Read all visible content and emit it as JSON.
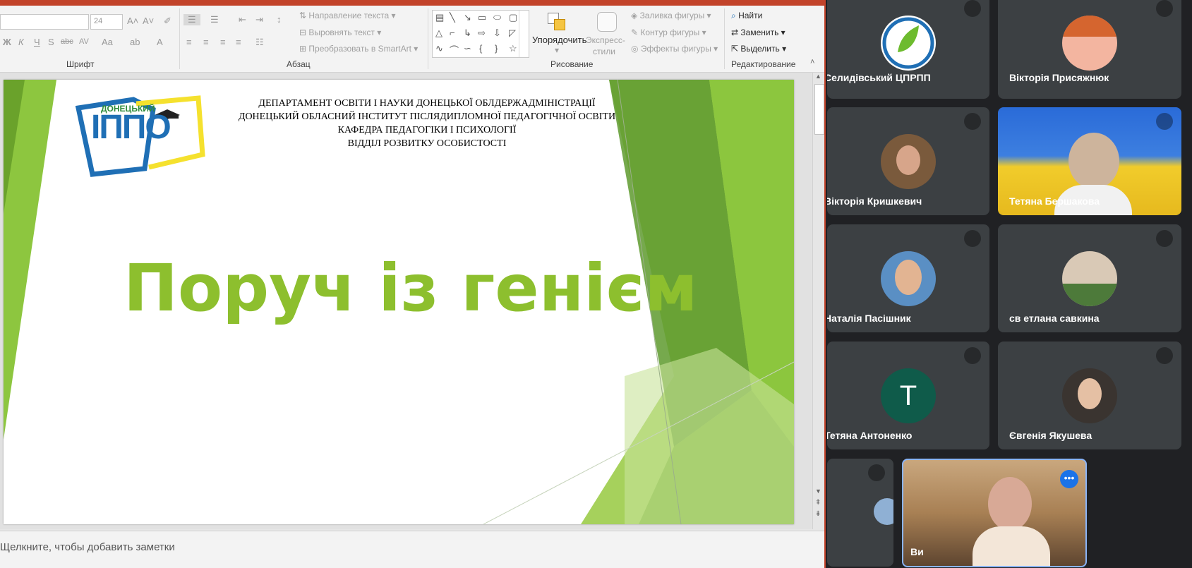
{
  "ppt": {
    "font_size_value": "24",
    "font_group_label": "Шрифт",
    "paragraph_group_label": "Абзац",
    "drawing_group_label": "Рисование",
    "editing_group_label": "Редактирование",
    "text_direction": "Направление текста",
    "align_text": "Выровнять текст",
    "convert_smartart": "Преобразовать в SmartArt",
    "arrange_label": "Упорядочить",
    "quick_styles_label": "Экспресс-",
    "quick_styles_label2": "стили",
    "shape_fill": "Заливка фигуры",
    "shape_outline": "Контур фигуры",
    "shape_effects": "Эффекты фигуры",
    "find_label": "Найти",
    "replace_label": "Заменить",
    "select_label": "Выделить",
    "format_letters": [
      "Ж",
      "К",
      "Ч",
      "S",
      "abc",
      "AV",
      "Aa"
    ],
    "notes_placeholder": "Щелкните, чтобы добавить заметки"
  },
  "slide": {
    "header_lines": [
      "ДЕПАРТАМЕНТ ОСВІТИ І НАУКИ ДОНЕЦЬКОЇ ОБЛДЕРЖАДМІНІСТРАЦІЇ",
      "ДОНЕЦЬКИЙ ОБЛАСНИЙ ІНСТИТУТ ПІСЛЯДИПЛОМНОЇ ПЕДАГОГІЧНОЇ ОСВІТИ",
      "КАФЕДРА ПЕДАГОГІКИ І ПСИХОЛОГІЇ",
      "ВІДДІЛ РОЗВИТКУ ОСОБИСТОСТІ"
    ],
    "logo_top": "ДОНЕЦЬКИЙ",
    "logo_main": "ІППО",
    "title": "Поруч із генієм"
  },
  "meet": {
    "accent_color": "#8ab4f8",
    "participants": [
      {
        "name": "Селидівський ЦПРПП"
      },
      {
        "name": "Вікторія Присяжнюк"
      },
      {
        "name": "Вікторія Кришкевич"
      },
      {
        "name": "Тетяна Бершакова"
      },
      {
        "name": "Наталія Пасішник"
      },
      {
        "name": "св етлана савкина"
      },
      {
        "name": "Тетяна Антоненко",
        "initial": "Т"
      },
      {
        "name": "Євгенія Якушева"
      },
      {
        "name": ""
      },
      {
        "name": "Ви"
      }
    ]
  }
}
